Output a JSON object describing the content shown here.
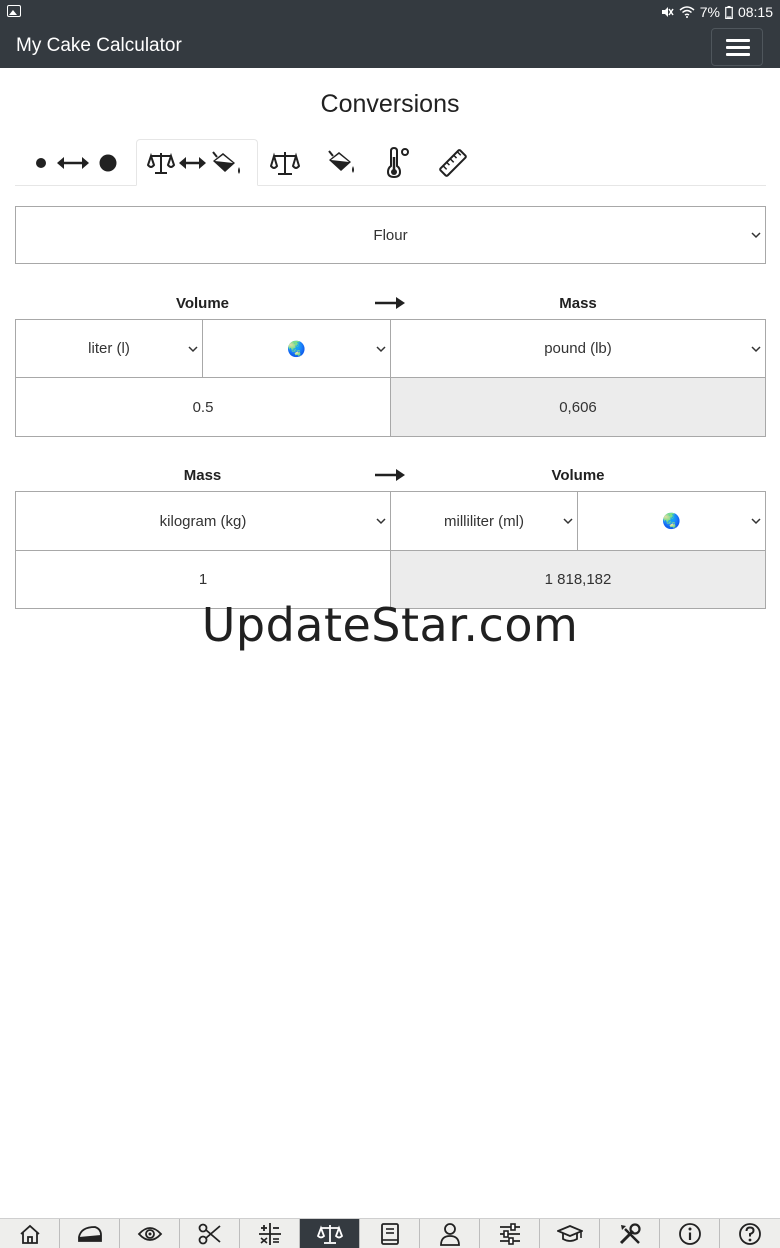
{
  "status_bar": {
    "battery": "7%",
    "time": "08:15",
    "icons": [
      "gallery-icon",
      "mute-icon",
      "wifi-icon",
      "battery-icon"
    ]
  },
  "app_bar": {
    "title": "My Cake Calculator",
    "menu_icon": "hamburger-icon"
  },
  "page": {
    "title": "Conversions"
  },
  "tabs": [
    {
      "icon": "size-convert-icon",
      "active": false
    },
    {
      "icon": "mass-volume-convert-icon",
      "active": true
    },
    {
      "icon": "scale-icon",
      "active": false
    },
    {
      "icon": "bucket-icon",
      "active": false
    },
    {
      "icon": "thermometer-icon",
      "active": false
    },
    {
      "icon": "ruler-icon",
      "active": false
    }
  ],
  "ingredient": {
    "selected": "Flour"
  },
  "conversion1": {
    "from_label": "Volume",
    "to_label": "Mass",
    "from_unit": "liter (l)",
    "region_icon": "🌏",
    "to_unit": "pound (lb)",
    "input_value": "0.5",
    "output_value": "0,606"
  },
  "conversion2": {
    "from_label": "Mass",
    "to_label": "Volume",
    "from_unit": "kilogram (kg)",
    "to_unit": "milliliter (ml)",
    "region_icon": "🌏",
    "input_value": "1",
    "output_value": "1 818,182"
  },
  "watermark": "UpdateStar.com",
  "bottom_nav": [
    {
      "icon": "home-icon",
      "active": false
    },
    {
      "icon": "cake-icon",
      "active": false
    },
    {
      "icon": "eye-icon",
      "active": false
    },
    {
      "icon": "scissors-icon",
      "active": false
    },
    {
      "icon": "calculator-icon",
      "active": false
    },
    {
      "icon": "scale-icon",
      "active": true
    },
    {
      "icon": "book-icon",
      "active": false
    },
    {
      "icon": "user-icon",
      "active": false
    },
    {
      "icon": "sliders-icon",
      "active": false
    },
    {
      "icon": "graduation-cap-icon",
      "active": false
    },
    {
      "icon": "tools-icon",
      "active": false
    },
    {
      "icon": "info-icon",
      "active": false
    },
    {
      "icon": "help-icon",
      "active": false
    }
  ],
  "colors": {
    "app_bar": "#343a40",
    "output_cell": "#ececec",
    "border": "#a8a8a8",
    "nav_bg": "#eeeeec"
  }
}
